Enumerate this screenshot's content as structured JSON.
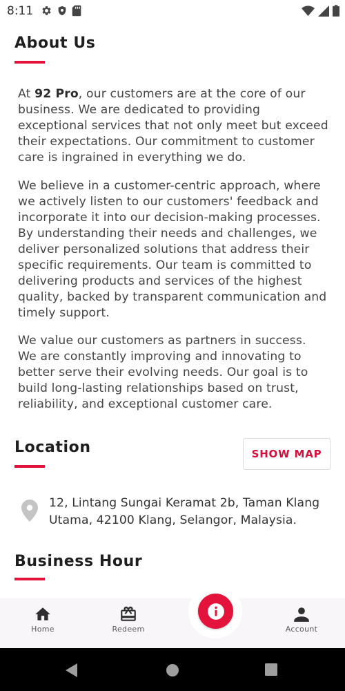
{
  "status_bar": {
    "time": "8:11",
    "left_icons": [
      "gear-icon",
      "shield-icon",
      "sd-card-icon"
    ],
    "right_icons": [
      "wifi-icon",
      "cellular-signal-icon",
      "battery-icon"
    ]
  },
  "about": {
    "title": "About Us",
    "p1_prefix": "At ",
    "p1_brand": "92 Pro",
    "p1_rest": ", our customers are at the core of our business. We are dedicated to providing exceptional services that not only meet but exceed their expectations. Our commitment to customer care is ingrained in everything we do.",
    "p2": "We believe in a customer-centric approach, where we actively listen to our customers' feedback and incorporate it into our decision-making processes. By understanding their needs and challenges, we deliver personalized solutions that address their specific requirements. Our team is committed to delivering products and services of the highest quality, backed by transparent communication and timely support.",
    "p3": "We value our customers as partners in success. We are constantly improving and innovating to better serve their evolving needs. Our goal is to build long-lasting relationships based on trust, reliability, and exceptional customer care."
  },
  "location": {
    "title": "Location",
    "show_map_label": "SHOW MAP",
    "address": "12, Lintang Sungai Keramat 2b, Taman Klang Utama, 42100 Klang, Selangor, Malaysia."
  },
  "business_hour": {
    "title": "Business Hour"
  },
  "bottom_nav": {
    "items": [
      {
        "label": "Home",
        "icon": "home-icon"
      },
      {
        "label": "Redeem",
        "icon": "gift-icon"
      },
      {
        "label": "",
        "icon": "info-icon"
      },
      {
        "label": "Account",
        "icon": "account-icon"
      }
    ]
  },
  "colors": {
    "accent": "#e3133c",
    "text": "#454545",
    "nav_bg": "#f8f6f8"
  }
}
